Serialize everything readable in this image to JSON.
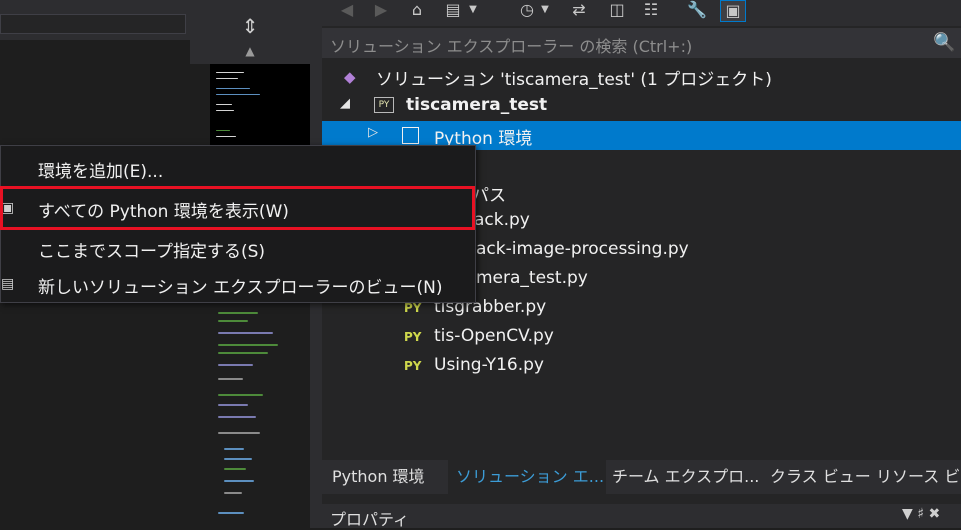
{
  "solution_explorer": {
    "search_placeholder": "ソリューション エクスプローラー の検索 (Ctrl+:)",
    "solution_label": "ソリューション 'tiscamera_test' (1 プロジェクト)",
    "project_label": "tiscamera_test",
    "env_node_label": "Python 環境",
    "partial_items": [
      "パス",
      "ack.py",
      "ack-image-processing.py",
      "mera_test.py"
    ],
    "files": [
      "tisgrabber.py",
      "tis-OpenCV.py",
      "Using-Y16.py"
    ],
    "py_badge": "PY"
  },
  "context_menu": {
    "items": [
      "環境を追加(E)...",
      "すべての Python 環境を表示(W)",
      "ここまでスコープ指定する(S)",
      "新しいソリューション エクスプローラーのビュー(N)"
    ]
  },
  "bottom_tabs": [
    "Python 環境",
    "ソリューション エ...",
    "チーム エクスプロ...",
    "クラス ビュー",
    "リソース ビュ"
  ],
  "properties_title": "プロパティ",
  "colors": {
    "selection": "#007acc",
    "highlight": "#e81123",
    "py": "#cfd84c"
  }
}
